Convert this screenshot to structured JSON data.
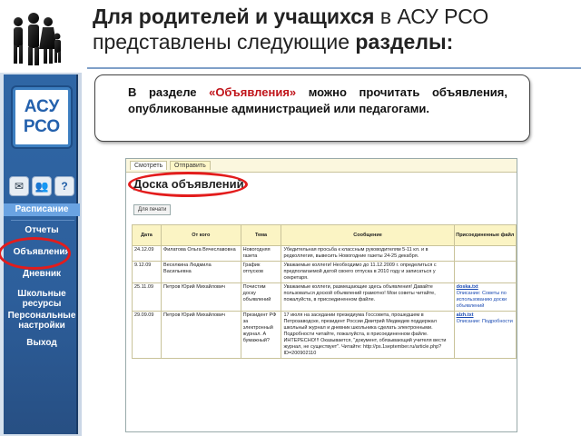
{
  "slide": {
    "title_bold": "Для родителей и учащихся",
    "title_part2": " в АСУ РСО",
    "title_line2_normal": "представлены следующие ",
    "title_line2_bold": "разделы:",
    "callout_prefix": "В разделе ",
    "callout_highlight": "«Объявления»",
    "callout_suffix": " можно прочитать объявления, опубликованные администрацией или педагогами."
  },
  "sidebar": {
    "logo_line1": "АСУ",
    "logo_line2": "РСО",
    "icons": [
      "mail-icon",
      "users-icon",
      "help-icon"
    ],
    "icon_glyphs": [
      "✉",
      "👥",
      "?"
    ],
    "items": [
      {
        "label": "Расписание",
        "active": true
      },
      {
        "label": "Отчеты",
        "active": false
      },
      {
        "label": "Объявления",
        "active": false
      },
      {
        "label": "Дневник",
        "active": false
      },
      {
        "label": "Школьные ресурсы",
        "active": false
      },
      {
        "label": "Персональные настройки",
        "active": false
      },
      {
        "label": "Выход",
        "active": false
      }
    ]
  },
  "screenshot": {
    "tabs": [
      "Смотреть",
      "Отправить"
    ],
    "board_title": "Доска объявлений",
    "print_button": "Для печати",
    "columns": [
      "Дата",
      "От кого",
      "Тема",
      "Сообщение",
      "Присоединенные файл"
    ],
    "rows": [
      {
        "date": "24.12.09",
        "from": "Филатова Ольга Вячеславовна",
        "topic": "Новогодняя газета",
        "message": "Убедительная просьба к классным руководителям 5-11 кл. и в редколлегия, вывесить Новогодние газеты 24-25 декабря.",
        "attach": "",
        "attach_meta": ""
      },
      {
        "date": "9.12.09",
        "from": "Веселкина Людмила Васильевна",
        "topic": "График отпусков",
        "message": "Уважаемые коллеги! Необходимо до 11.12.2009 г. определиться с предполагаемой датой своего отпуска в 2010 году и записаться у секретаря.",
        "attach": "",
        "attach_meta": ""
      },
      {
        "date": "25.11.09",
        "from": "Петров Юрий Михайлович",
        "topic": "Почистим доску объявлений",
        "message": "Уважаемые коллеги, размещающие здесь объявления! Давайте пользоваться доской объявлений грамотно! Мои советы читайте, пожалуйста, в присоединенном файле.",
        "attach": "doska.txt",
        "attach_meta": "Описание: Советы по использованию доски объявлений"
      },
      {
        "date": "29.09.09",
        "from": "Петров Юрий Михайлович",
        "topic": "Президент РФ за электронный журнал. А бумажный?",
        "message": "17 июля на заседании президиума Госсовета, прошедшем в Петрозаводске, президент России Дмитрий Медведев поддержал школьный журнал и дневник школьника сделать электронными. Подробности читайте, пожалуйста, в присоединенном файле. ИНТЕРЕСНО!!! Оказывается, \"документ, обязывающий учителя вести журнал, не существует\". Читайте: http://ps.1september.ru/article.php?ID=200902110",
        "attach": "alzh.txt",
        "attach_meta": "Описание: Подробности"
      }
    ]
  }
}
